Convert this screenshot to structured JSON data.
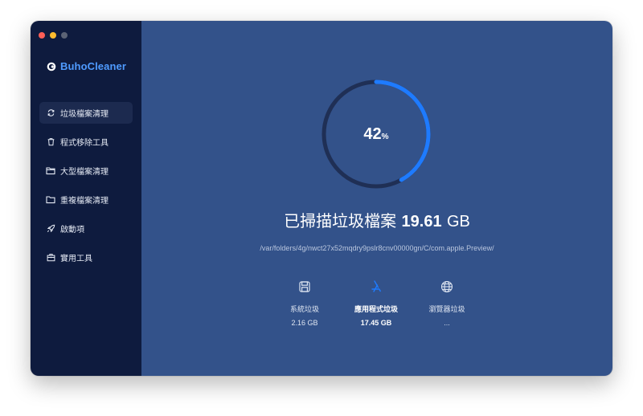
{
  "app": {
    "name": "BuhoCleaner"
  },
  "sidebar": {
    "items": [
      {
        "label": "垃圾檔案清理",
        "icon": "sync-icon",
        "active": true
      },
      {
        "label": "程式移除工具",
        "icon": "trash-icon",
        "active": false
      },
      {
        "label": "大型檔案清理",
        "icon": "folder-icon",
        "active": false
      },
      {
        "label": "重複檔案清理",
        "icon": "folder-duplicate-icon",
        "active": false
      },
      {
        "label": "啟動項",
        "icon": "rocket-icon",
        "active": false
      },
      {
        "label": "實用工具",
        "icon": "toolbox-icon",
        "active": false
      }
    ]
  },
  "scan": {
    "progress_value": "42",
    "progress_unit": "%",
    "progress_fraction": 0.42,
    "headline_prefix": "已掃描垃圾檔案",
    "headline_size": "19.61",
    "headline_unit": "GB",
    "current_path": "/var/folders/4g/nwct27x52mqdry9pslr8cnv00000gn/C/com.apple.Preview/"
  },
  "categories": [
    {
      "label": "系統垃圾",
      "value": "2.16 GB",
      "icon": "disk-icon",
      "active": false
    },
    {
      "label": "應用程式垃圾",
      "value": "17.45 GB",
      "icon": "app-store-icon",
      "active": true
    },
    {
      "label": "瀏覽器垃圾",
      "value": "...",
      "icon": "globe-icon",
      "active": false
    }
  ],
  "colors": {
    "accent": "#1e7bff",
    "ring_track": "#1f2f55",
    "sidebar_bg": "#0e1b3e",
    "main_bg": "#33528a"
  }
}
